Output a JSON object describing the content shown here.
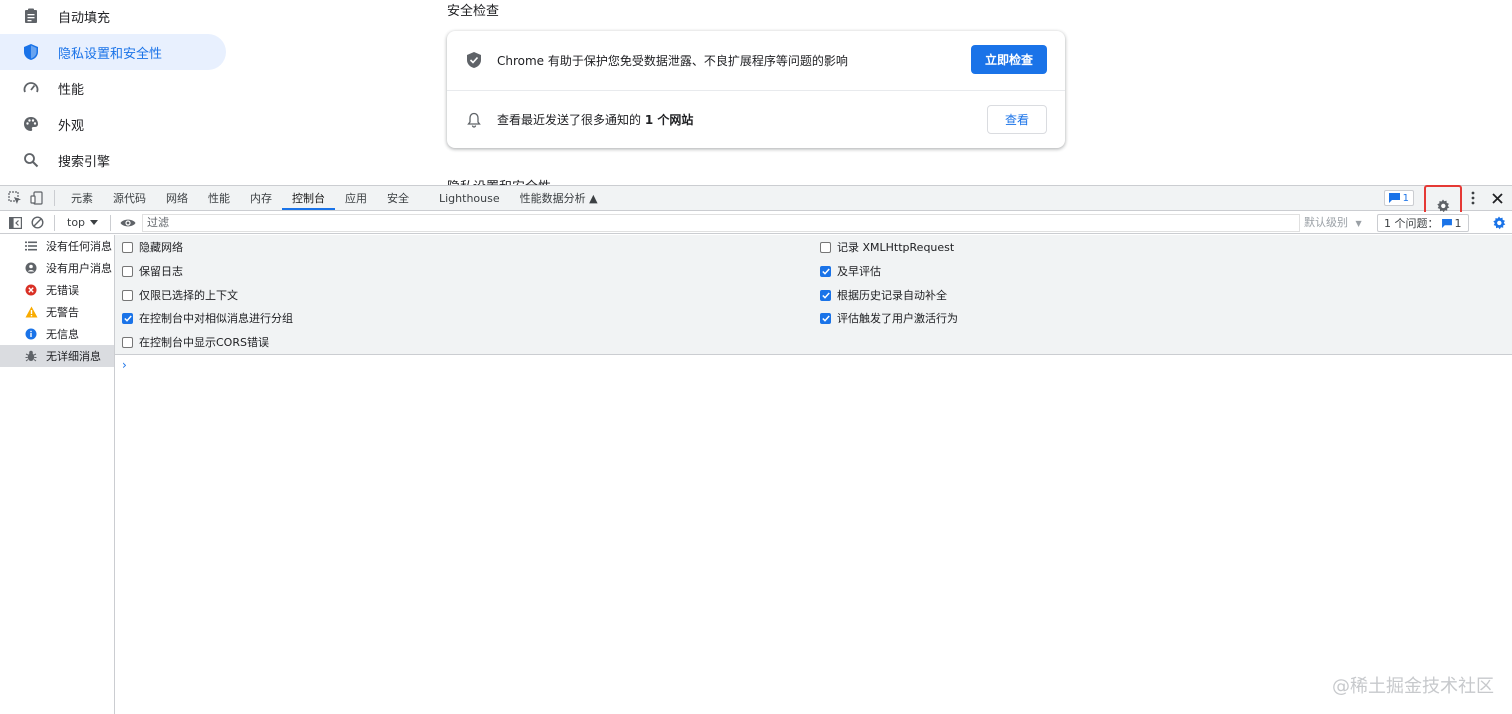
{
  "settings_page": {
    "nav": [
      {
        "label": "自动填充",
        "icon": "clipboard-icon",
        "active": false
      },
      {
        "label": "隐私设置和安全性",
        "icon": "shield-icon",
        "active": true
      },
      {
        "label": "性能",
        "icon": "speedometer-icon",
        "active": false
      },
      {
        "label": "外观",
        "icon": "palette-icon",
        "active": false
      },
      {
        "label": "搜索引擎",
        "icon": "search-icon",
        "active": false
      }
    ],
    "section_title": "安全检查",
    "safety_row": {
      "text": "Chrome 有助于保护您免受数据泄露、不良扩展程序等问题的影响",
      "button": "立即检查"
    },
    "notif_row": {
      "text_prefix": "查看最近发送了很多通知的 ",
      "text_bold": "1 个网站",
      "button": "查看"
    },
    "next_section_title": "隐私设置和安全性"
  },
  "devtools": {
    "tabs": [
      "元素",
      "源代码",
      "网络",
      "性能",
      "内存",
      "控制台",
      "应用",
      "安全",
      "Lighthouse",
      "性能数据分析 ▲"
    ],
    "active_tab": "控制台",
    "issue_count": "1",
    "toolbar": {
      "context": "top",
      "filter_placeholder": "过滤",
      "level": "默认级别",
      "issues_label": "1 个问题：",
      "issues_count": "1"
    },
    "sidebar": [
      {
        "label": "没有任何消息",
        "icon": "list-icon"
      },
      {
        "label": "没有用户消息",
        "icon": "user-icon"
      },
      {
        "label": "无错误",
        "icon": "error-icon"
      },
      {
        "label": "无警告",
        "icon": "warning-icon"
      },
      {
        "label": "无信息",
        "icon": "info-icon"
      },
      {
        "label": "无详细消息",
        "icon": "bug-icon"
      }
    ],
    "options_left": [
      {
        "label": "隐藏网络",
        "checked": false
      },
      {
        "label": "保留日志",
        "checked": false
      },
      {
        "label": "仅限已选择的上下文",
        "checked": false
      },
      {
        "label": "在控制台中对相似消息进行分组",
        "checked": true
      },
      {
        "label": "在控制台中显示CORS错误",
        "checked": false
      }
    ],
    "options_right": [
      {
        "label": "记录 XMLHttpRequest",
        "checked": false
      },
      {
        "label": "及早评估",
        "checked": true
      },
      {
        "label": "根据历史记录自动补全",
        "checked": true
      },
      {
        "label": "评估触发了用户激活行为",
        "checked": true
      }
    ],
    "prompt": "›"
  },
  "watermark": "@稀土掘金技术社区",
  "colors": {
    "accent": "#1a73e8",
    "highlight": "#e53935"
  }
}
